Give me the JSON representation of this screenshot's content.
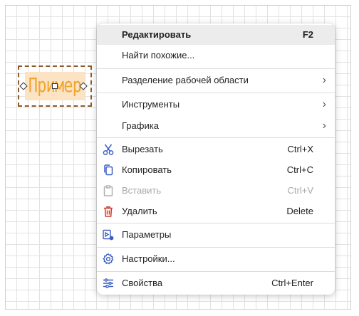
{
  "canvas": {
    "sample_text": "Пример"
  },
  "menu": {
    "items": [
      {
        "label": "Редактировать",
        "shortcut": "F2"
      },
      {
        "label": "Найти похожие..."
      },
      {
        "label": "Разделение рабочей области",
        "arrow": "›"
      },
      {
        "label": "Инструменты",
        "arrow": "›"
      },
      {
        "label": "Графика",
        "arrow": "›"
      },
      {
        "label": "Вырезать",
        "shortcut": "Ctrl+X",
        "icon": "scissors-icon"
      },
      {
        "label": "Копировать",
        "shortcut": "Ctrl+C",
        "icon": "copy-icon"
      },
      {
        "label": "Вставить",
        "shortcut": "Ctrl+V",
        "icon": "paste-icon",
        "disabled": true
      },
      {
        "label": "Удалить",
        "shortcut": "Delete",
        "icon": "trash-icon"
      },
      {
        "label": "Параметры",
        "icon": "parameters-icon"
      },
      {
        "label": "Настройки...",
        "icon": "gear-icon"
      },
      {
        "label": "Свойства",
        "shortcut": "Ctrl+Enter",
        "icon": "properties-icon"
      }
    ]
  },
  "colors": {
    "icon_blue": "#3a5fc4",
    "icon_red": "#d33a2c",
    "disabled_gray": "#b0b0b0",
    "sample_orange": "#f0a52e",
    "selection_brown": "#8a5a2b"
  }
}
